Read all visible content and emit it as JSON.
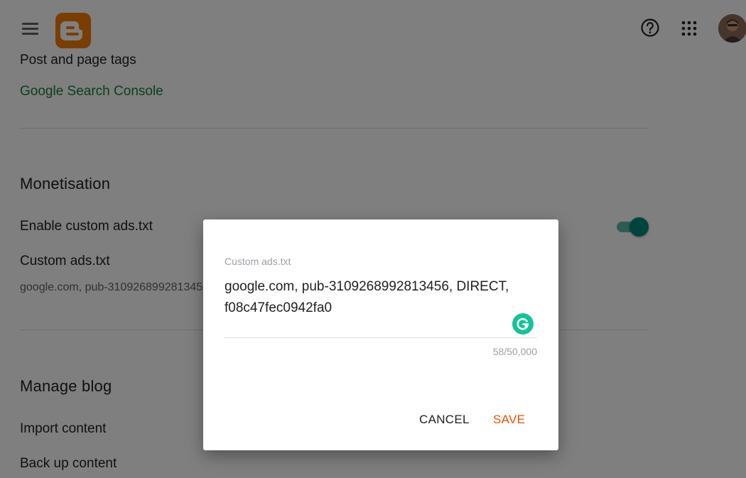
{
  "topbar": {
    "menu_icon": "hamburger-menu-icon",
    "logo_icon": "blogger-logo-icon",
    "help_icon": "help-circle-icon",
    "apps_icon": "apps-grid-icon",
    "avatar": "user-avatar"
  },
  "settings": {
    "post_page_tags": "Post and page tags",
    "search_console_link": "Google Search Console",
    "monetisation": {
      "title": "Monetisation",
      "enable_custom_ads": "Enable custom ads.txt",
      "enable_custom_ads_on": true,
      "custom_ads_label": "Custom ads.txt",
      "custom_ads_value": "google.com, pub-3109268992813456, DIRECT, f08c47fec0942fa0"
    },
    "manage_blog": {
      "title": "Manage blog",
      "import_content": "Import content",
      "back_up_content": "Back up content"
    }
  },
  "dialog": {
    "field_label": "Custom ads.txt",
    "field_value": "google.com, pub-3109268992813456, DIRECT,\nf08c47fec0942fa0",
    "char_count": "58/50,000",
    "cancel_label": "CANCEL",
    "save_label": "SAVE",
    "assistant_icon": "grammarly-icon"
  },
  "colors": {
    "accent_green": "#00897b",
    "link_green": "#188038",
    "save_orange": "#e65100",
    "logo_orange": "#f57c00",
    "grammarly_green": "#15c39a"
  }
}
